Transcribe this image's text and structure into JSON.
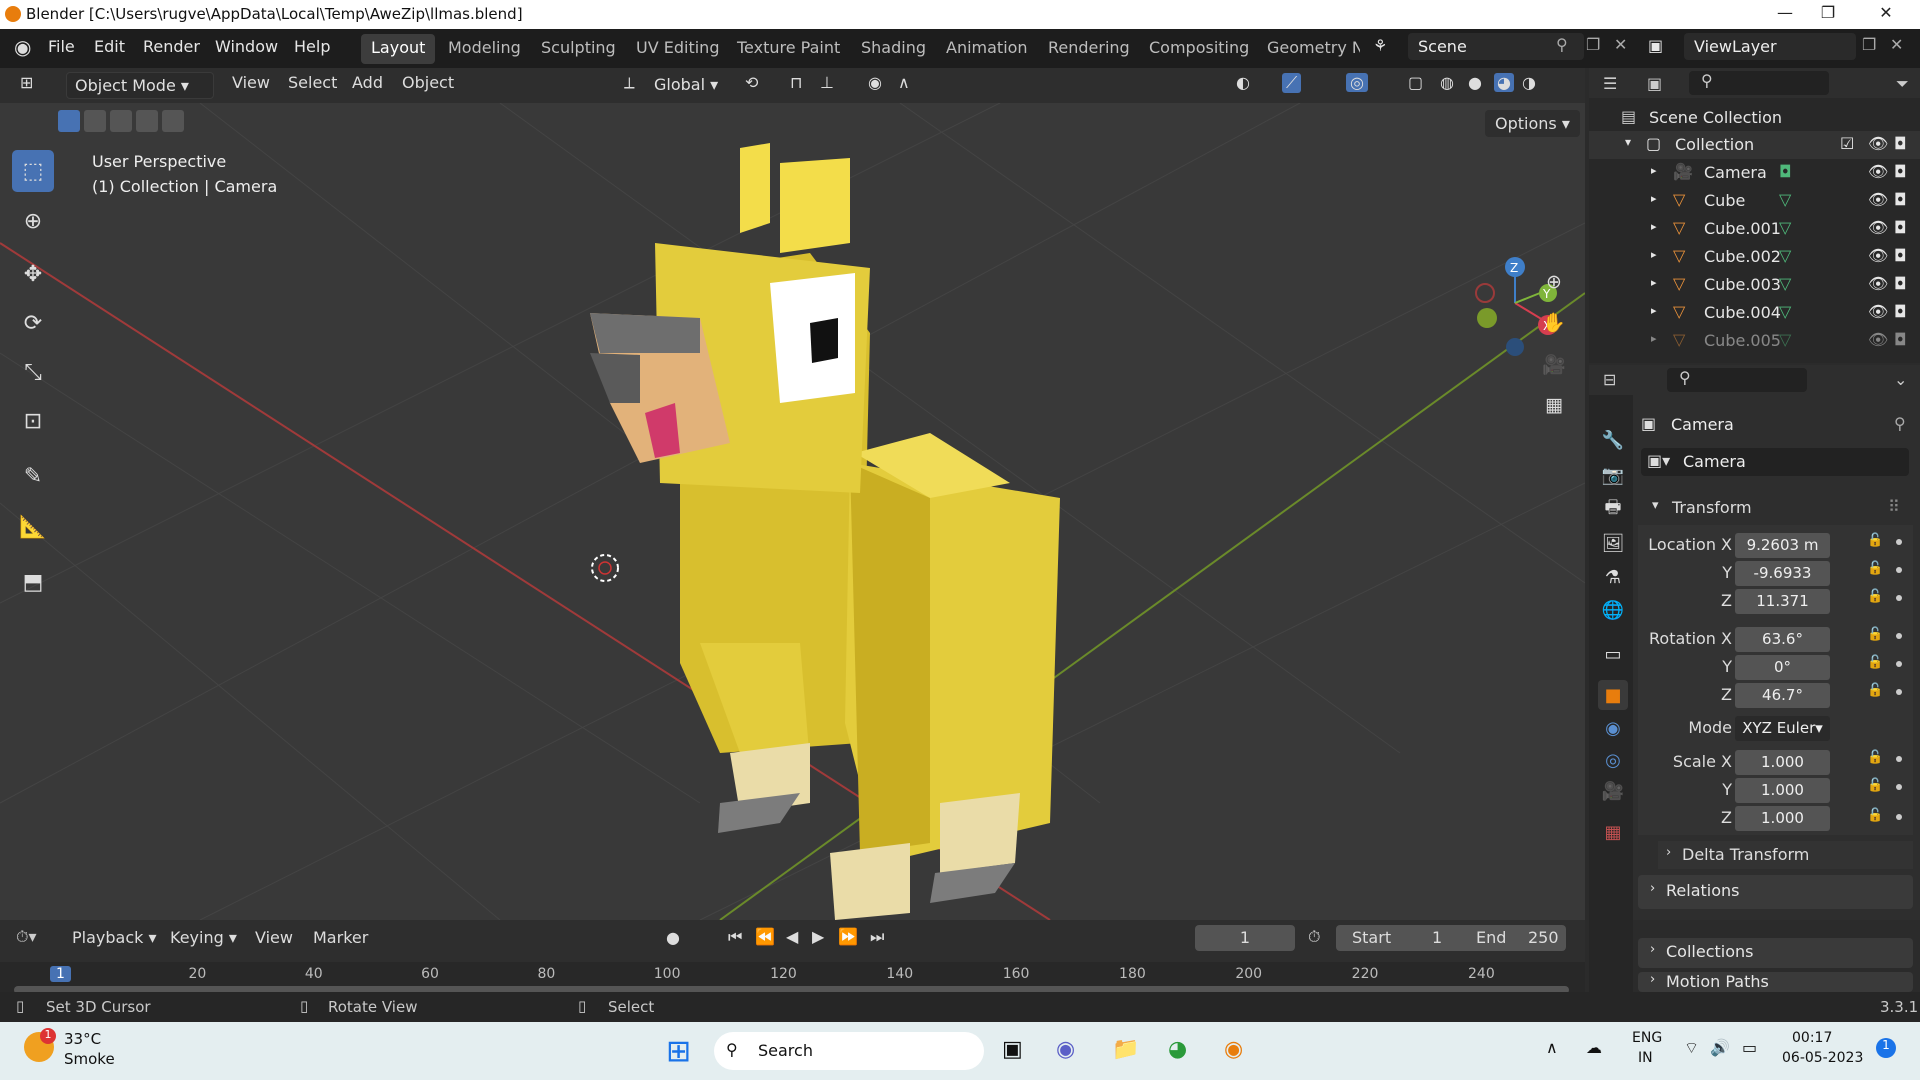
{
  "window": {
    "title": "Blender [C:\\Users\\rugve\\AppData\\Local\\Temp\\AweZip\\llmas.blend]",
    "minimize": "—",
    "maximize": "❐",
    "close": "✕"
  },
  "menu": {
    "file": "File",
    "edit": "Edit",
    "render": "Render",
    "window": "Window",
    "help": "Help"
  },
  "workspaces": [
    "Layout",
    "Modeling",
    "Sculpting",
    "UV Editing",
    "Texture Paint",
    "Shading",
    "Animation",
    "Rendering",
    "Compositing",
    "Geometry Nodes"
  ],
  "scene": {
    "name": "Scene",
    "viewlayer": "ViewLayer"
  },
  "header3d": {
    "mode": "Object Mode",
    "view": "View",
    "select": "Select",
    "add": "Add",
    "object": "Object",
    "orientation": "Global",
    "options": "Options"
  },
  "viewport": {
    "perspective": "User Perspective",
    "context": "(1) Collection | Camera",
    "axis_x": "X",
    "axis_y": "Y",
    "axis_z": "Z"
  },
  "outliner": {
    "scene_collection": "Scene Collection",
    "collection": "Collection",
    "items": [
      {
        "name": "Camera",
        "type": "camera"
      },
      {
        "name": "Cube",
        "type": "mesh"
      },
      {
        "name": "Cube.001",
        "type": "mesh"
      },
      {
        "name": "Cube.002",
        "type": "mesh"
      },
      {
        "name": "Cube.003",
        "type": "mesh"
      },
      {
        "name": "Cube.004",
        "type": "mesh"
      },
      {
        "name": "Cube.005",
        "type": "mesh"
      }
    ]
  },
  "properties": {
    "object_name": "Camera",
    "data_name": "Camera",
    "transform": "Transform",
    "location_label": "Location X",
    "location": {
      "x": "9.2603 m",
      "y": "-9.6933",
      "z": "11.371"
    },
    "rotation_label": "Rotation X",
    "rotation": {
      "x": "63.6°",
      "y": "0°",
      "z": "46.7°"
    },
    "mode_label": "Mode",
    "mode": "XYZ Euler",
    "scale_label": "Scale X",
    "scale": {
      "x": "1.000",
      "y": "1.000",
      "z": "1.000"
    },
    "y": "Y",
    "z": "Z",
    "delta": "Delta Transform",
    "relations": "Relations",
    "collections": "Collections",
    "motion_paths": "Motion Paths"
  },
  "timeline": {
    "playback": "Playback",
    "keying": "Keying",
    "view": "View",
    "marker": "Marker",
    "current_frame": "1",
    "start_label": "Start",
    "start": "1",
    "end_label": "End",
    "end": "250",
    "ticks": [
      "1",
      "20",
      "40",
      "60",
      "80",
      "100",
      "120",
      "140",
      "160",
      "180",
      "200",
      "220",
      "240"
    ]
  },
  "status": {
    "cursor": "Set 3D Cursor",
    "rotate": "Rotate View",
    "select": "Select",
    "version": "3.3.1"
  },
  "taskbar": {
    "temp": "33°C",
    "weather": "Smoke",
    "badge": "1",
    "search": "Search",
    "lang1": "ENG",
    "lang2": "IN",
    "time": "00:17",
    "date": "06-05-2023",
    "notif": "1"
  },
  "colors": {
    "accent": "#4772b3",
    "llama": "#e8cf3a",
    "bg": "#393939"
  }
}
